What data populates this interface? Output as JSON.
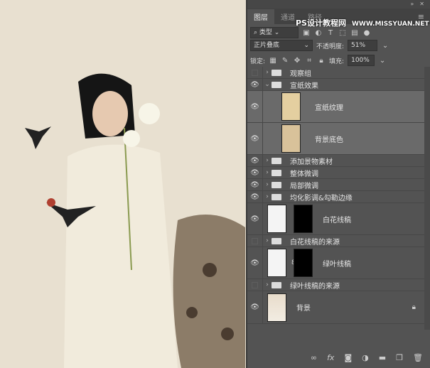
{
  "panel": {
    "tabs": [
      "图层",
      "通道",
      "路径"
    ],
    "watermark": {
      "cn": "PS设计教程网",
      "url": "WWW.MISSYUAN.NET"
    },
    "filter": {
      "kind": "类型"
    },
    "blend_mode": "正片叠底",
    "opacity_label": "不透明度:",
    "opacity": "51%",
    "lock_label": "锁定:",
    "fill_label": "填充:",
    "fill": "100%",
    "layers": [
      {
        "name": "观察组",
        "type": "group",
        "visible": false,
        "expanded": false
      },
      {
        "name": "宣纸效果",
        "type": "group",
        "visible": true,
        "expanded": true
      },
      {
        "name": "宣纸纹理",
        "type": "layer",
        "visible": true,
        "selected": true,
        "thumb": "#e4cfa0"
      },
      {
        "name": "背景底色",
        "type": "layer",
        "visible": true,
        "selected": true,
        "thumb": "#d9c29a"
      },
      {
        "name": "添加景物素材",
        "type": "group",
        "visible": true
      },
      {
        "name": "整体微调",
        "type": "group",
        "visible": true
      },
      {
        "name": "局部微调",
        "type": "group",
        "visible": true
      },
      {
        "name": "均化影调&勾勒边缘",
        "type": "group",
        "visible": true
      },
      {
        "name": "白花线稿",
        "type": "masked",
        "visible": true
      },
      {
        "name": "白花线稿的来源",
        "type": "group",
        "visible": false
      },
      {
        "name": "绿叶线稿",
        "type": "masked",
        "visible": true,
        "linked": true
      },
      {
        "name": "绿叶线稿的来源",
        "type": "group",
        "visible": false
      },
      {
        "name": "背景",
        "type": "background",
        "visible": true,
        "locked": true
      }
    ]
  }
}
